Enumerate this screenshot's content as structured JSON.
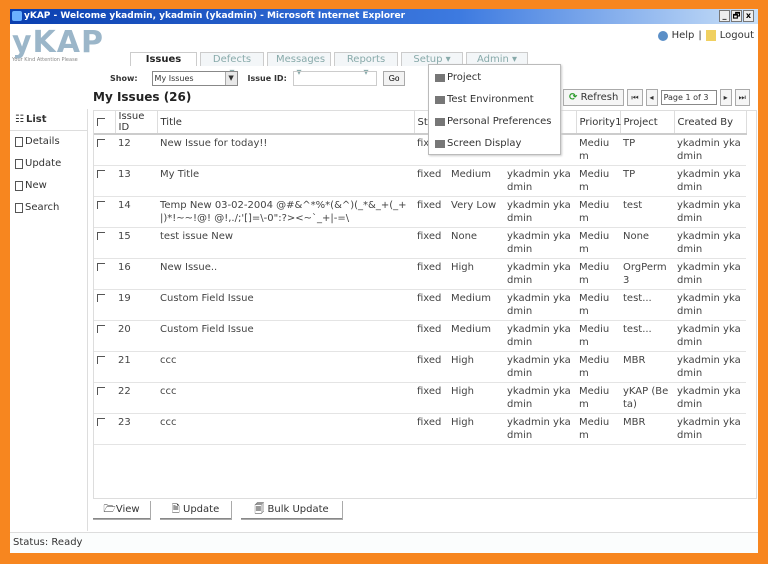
{
  "window": {
    "title": "yKAP - Welcome ykadmin, ykadmin (ykadmin) - Microsoft Internet Explorer",
    "controls": [
      "_",
      "🗗",
      "x"
    ]
  },
  "brand": {
    "logo": "yKAP",
    "tagline": "Your Kind Attention Please"
  },
  "toplinks": {
    "help": "Help",
    "separator": "|",
    "logout": "Logout"
  },
  "tabs": [
    {
      "label": "Issues"
    },
    {
      "label": "Defects ▾"
    },
    {
      "label": "Messages ▾"
    },
    {
      "label": "Reports ▾"
    },
    {
      "label": "Setup ▾"
    },
    {
      "label": "Admin ▾"
    }
  ],
  "filter": {
    "show_label": "Show:",
    "show_value": "My Issues",
    "issue_id_label": "Issue ID:",
    "issue_id_value": "",
    "go": "Go"
  },
  "heading": "My Issues (26)",
  "sidebar": {
    "items": [
      {
        "label": "List"
      },
      {
        "label": "Details"
      },
      {
        "label": "Update"
      },
      {
        "label": "New"
      },
      {
        "label": "Search"
      }
    ]
  },
  "setup_menu": {
    "items": [
      {
        "label": "Project"
      },
      {
        "label": "Test Environment"
      },
      {
        "label": "Personal Preferences"
      },
      {
        "label": "Screen Display"
      }
    ]
  },
  "pager": {
    "refresh": "Refresh",
    "first": "⏮",
    "prev": "◂",
    "page": "Page 1 of 3",
    "next": "▸",
    "last": "⏭"
  },
  "table": {
    "headers": [
      "",
      "Issue ID",
      "Title",
      "St",
      "",
      "",
      "Priority1",
      "Project",
      "Created By"
    ],
    "rows": [
      {
        "id": "12",
        "title": "New Issue for today!!",
        "status": "fix",
        "priority": "",
        "assigned": "",
        "priority1": "Medium",
        "project": "TP",
        "created": "ykadmin ykadmin"
      },
      {
        "id": "13",
        "title": "My Title",
        "status": "fixed",
        "priority": "Medium",
        "assigned": "ykadmin ykadmin",
        "priority1": "Medium",
        "project": "TP",
        "created": "ykadmin ykadmin"
      },
      {
        "id": "14",
        "title": "Temp New 03-02-2004 @#&^*%*(&^)(_*&_+(_+|)*!~~!@! @!,./;'[]=\\-0\":?><~`_+|-=\\",
        "status": "fixed",
        "priority": "Very Low",
        "assigned": "ykadmin ykadmin",
        "priority1": "Medium",
        "project": "test",
        "created": "ykadmin ykadmin"
      },
      {
        "id": "15",
        "title": "test issue New",
        "status": "fixed",
        "priority": "None",
        "assigned": "ykadmin ykadmin",
        "priority1": "Medium",
        "project": "None",
        "created": "ykadmin ykadmin"
      },
      {
        "id": "16",
        "title": "New Issue..",
        "status": "fixed",
        "priority": "High",
        "assigned": "ykadmin ykadmin",
        "priority1": "Medium",
        "project": "OrgPerm3",
        "created": "ykadmin ykadmin"
      },
      {
        "id": "19",
        "title": "Custom Field Issue",
        "status": "fixed",
        "priority": "Medium",
        "assigned": "ykadmin ykadmin",
        "priority1": "Medium",
        "project": "test...",
        "created": "ykadmin ykadmin"
      },
      {
        "id": "20",
        "title": "Custom Field Issue",
        "status": "fixed",
        "priority": "Medium",
        "assigned": "ykadmin ykadmin",
        "priority1": "Medium",
        "project": "test...",
        "created": "ykadmin ykadmin"
      },
      {
        "id": "21",
        "title": "ccc",
        "status": "fixed",
        "priority": "High",
        "assigned": "ykadmin ykadmin",
        "priority1": "Medium",
        "project": "MBR",
        "created": "ykadmin ykadmin"
      },
      {
        "id": "22",
        "title": "ccc",
        "status": "fixed",
        "priority": "High",
        "assigned": "ykadmin ykadmin",
        "priority1": "Medium",
        "project": "yKAP (Beta)",
        "created": "ykadmin ykadmin"
      },
      {
        "id": "23",
        "title": "ccc",
        "status": "fixed",
        "priority": "High",
        "assigned": "ykadmin ykadmin",
        "priority1": "Medium",
        "project": "MBR",
        "created": "ykadmin ykadmin"
      }
    ]
  },
  "actions": {
    "view": "View",
    "update": "Update",
    "bulk_update": "Bulk Update"
  },
  "status": "Status: Ready"
}
